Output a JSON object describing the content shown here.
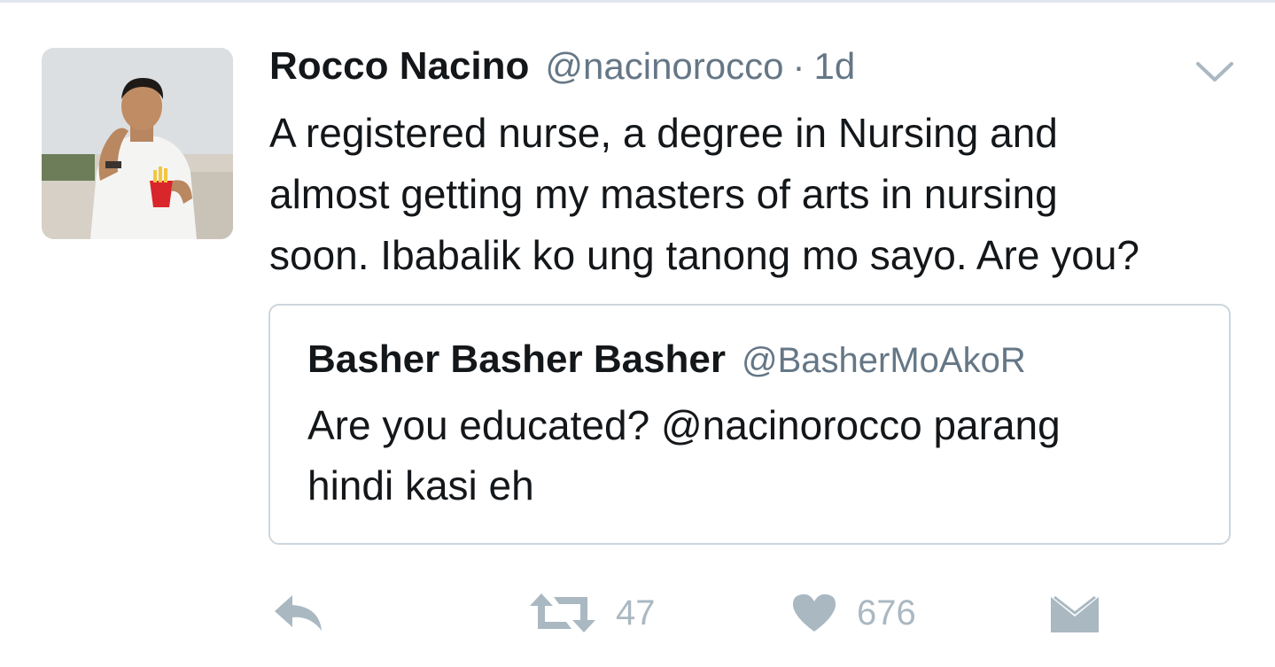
{
  "tweet": {
    "author": {
      "display_name": "Rocco Nacino",
      "handle": "@nacinorocco",
      "avatar": "profile-photo"
    },
    "separator": "·",
    "time": "1d",
    "text_lines": [
      "A registered nurse, a degree in Nursing and",
      "almost getting my masters of arts in nursing",
      "soon. Ibabalik ko ung tanong mo sayo. Are you?"
    ]
  },
  "quoted_tweet": {
    "display_name": "Basher Basher Basher",
    "handle": "@BasherMoAkoR",
    "text_lines": [
      "Are you educated? @nacinorocco parang",
      "hindi kasi eh"
    ]
  },
  "actions": {
    "reply": {
      "icon": "reply-icon"
    },
    "retweet": {
      "icon": "retweet-icon",
      "count": "47"
    },
    "like": {
      "icon": "heart-icon",
      "count": "676"
    },
    "message": {
      "icon": "envelope-icon"
    }
  },
  "colors": {
    "text": "#14171a",
    "secondary": "#657786",
    "action_gray": "#aab8c2",
    "border": "#ccd6dd"
  }
}
